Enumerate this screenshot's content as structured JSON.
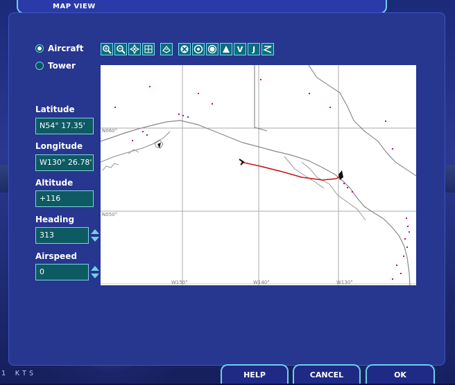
{
  "window": {
    "title": "MAP VIEW"
  },
  "mode": {
    "options": [
      {
        "label": "Aircraft",
        "selected": true
      },
      {
        "label": "Tower",
        "selected": false
      }
    ]
  },
  "fields": {
    "latitude": {
      "label": "Latitude",
      "value": "N54° 17.35'"
    },
    "longitude": {
      "label": "Longitude",
      "value": "W130° 26.78'"
    },
    "altitude": {
      "label": "Altitude",
      "value": "+116"
    },
    "heading": {
      "label": "Heading",
      "value": "313"
    },
    "airspeed": {
      "label": "Airspeed",
      "value": "0"
    }
  },
  "toolbar": {
    "icons": [
      "zoom-in-icon",
      "zoom-out-icon",
      "center-aircraft-icon",
      "grid-icon",
      "airports-icon",
      "vor-icon",
      "ndb-icon",
      "ils-icon",
      "intersection-icon",
      "v-airways-icon",
      "j-airways-icon",
      "flight-path-icon"
    ],
    "v_label": "V",
    "j_label": "J"
  },
  "map": {
    "grid_labels": {
      "lat_60": "N060°",
      "lat_50": "N050°",
      "lon_150": "W150°",
      "lon_140": "W140°",
      "lon_130": "W130°"
    },
    "colors": {
      "coast": "#8a8a8a",
      "grid": "#a0a0a0",
      "route": "#cc1111",
      "points": "#c0008c"
    }
  },
  "buttons": {
    "help": "HELP",
    "cancel": "CANCEL",
    "ok": "OK"
  },
  "status": {
    "speed_units": "1 KTS"
  },
  "colors": {
    "panel": "#27368f",
    "field_bg": "#0e5a62",
    "accent": "#6fd0e8"
  }
}
